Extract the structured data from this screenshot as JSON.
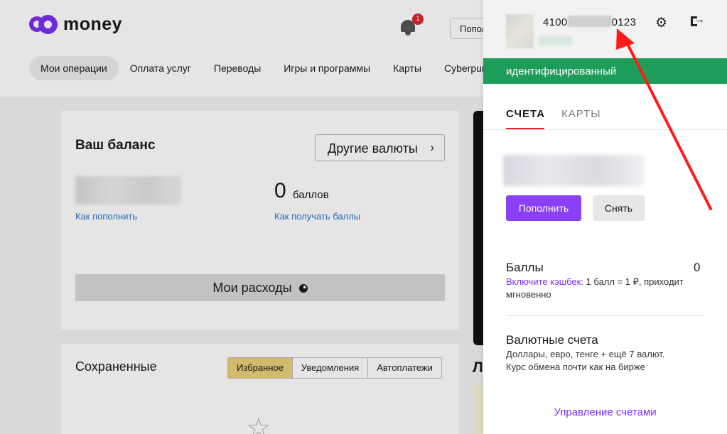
{
  "header": {
    "logo_text": "money",
    "notification_count": "1",
    "pay_button_label": "Попол."
  },
  "nav": {
    "items": [
      {
        "label": "Мои операции",
        "active": true
      },
      {
        "label": "Оплата услуг"
      },
      {
        "label": "Переводы"
      },
      {
        "label": "Игры и программы"
      },
      {
        "label": "Карты"
      },
      {
        "label": "Cyberpun"
      }
    ]
  },
  "balance": {
    "title": "Ваш баланс",
    "other_currencies": "Другие валюты",
    "how_to_topup": "Как пополнить",
    "points_value": "0",
    "points_unit": "баллов",
    "how_to_get_points": "Как получать баллы",
    "my_expenses": "Мои расходы"
  },
  "saved": {
    "title": "Сохраненные",
    "tabs": [
      "Избранное",
      "Уведомления",
      "Автоплатежи"
    ]
  },
  "side_letter": "Л",
  "panel": {
    "account_prefix": "4100",
    "account_suffix": "0123",
    "status": "идентифицированный",
    "tabs": {
      "accounts": "СЧЕТА",
      "cards": "КАРТЫ"
    },
    "topup_button": "Пополнить",
    "withdraw_button": "Снять",
    "points": {
      "title": "Баллы",
      "count": "0",
      "cashback_link": "Включите кэшбек:",
      "description": " 1 балл = 1 ₽, приходит мгновенно"
    },
    "currency_accounts": {
      "title": "Валютные счета",
      "line1": "Доллары, евро, тенге + ещё 7 валют.",
      "line2": "Курс обмена почти как на бирже"
    },
    "manage_link": "Управление счетами"
  },
  "colors": {
    "brand": "#7b2ff0",
    "status_green": "#1e9d5a",
    "annotation_arrow": "#ff1a1a"
  }
}
